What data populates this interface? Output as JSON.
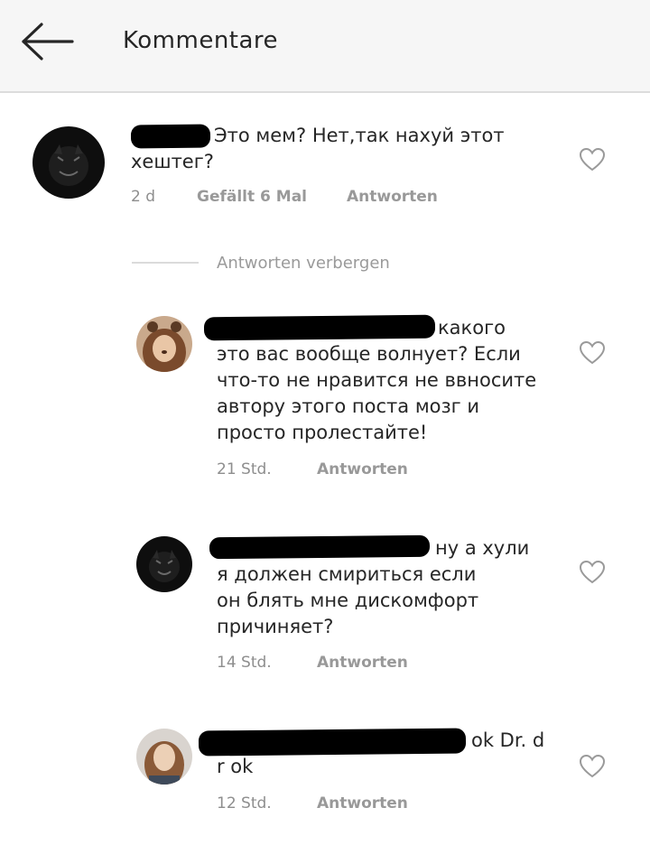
{
  "header": {
    "title": "Kommentare"
  },
  "toggle": {
    "hide_replies_label": "Antworten verbergen"
  },
  "comments": [
    {
      "line1": "Это мем? Нет,так нахуй этот",
      "rest": "хештег?",
      "time": "2 d",
      "likes": "Gefällt 6 Mal",
      "reply": "Antworten"
    },
    {
      "line1": "какого",
      "rest": "это вас вообще волнует? Если\nчто-то не нравится не ввносите\nавтору этого поста мозг и\nпросто пролестайте!",
      "time": "21 Std.",
      "reply": "Antworten"
    },
    {
      "line1": "ну а хули",
      "rest": "я должен смириться если\nон блять мне дискомфорт\nпричиняет?",
      "time": "14 Std.",
      "reply": "Antworten"
    },
    {
      "line1": "ok Dr. d",
      "rest": "r ok",
      "time": "12 Std.",
      "reply": "Antworten"
    }
  ],
  "colors": {
    "header_bg": "#f6f6f6",
    "text": "#262626",
    "meta": "#8e8e8e",
    "redaction": "#000000"
  },
  "icons": {
    "back": "arrow-left-icon",
    "like": "heart-outline-icon"
  }
}
